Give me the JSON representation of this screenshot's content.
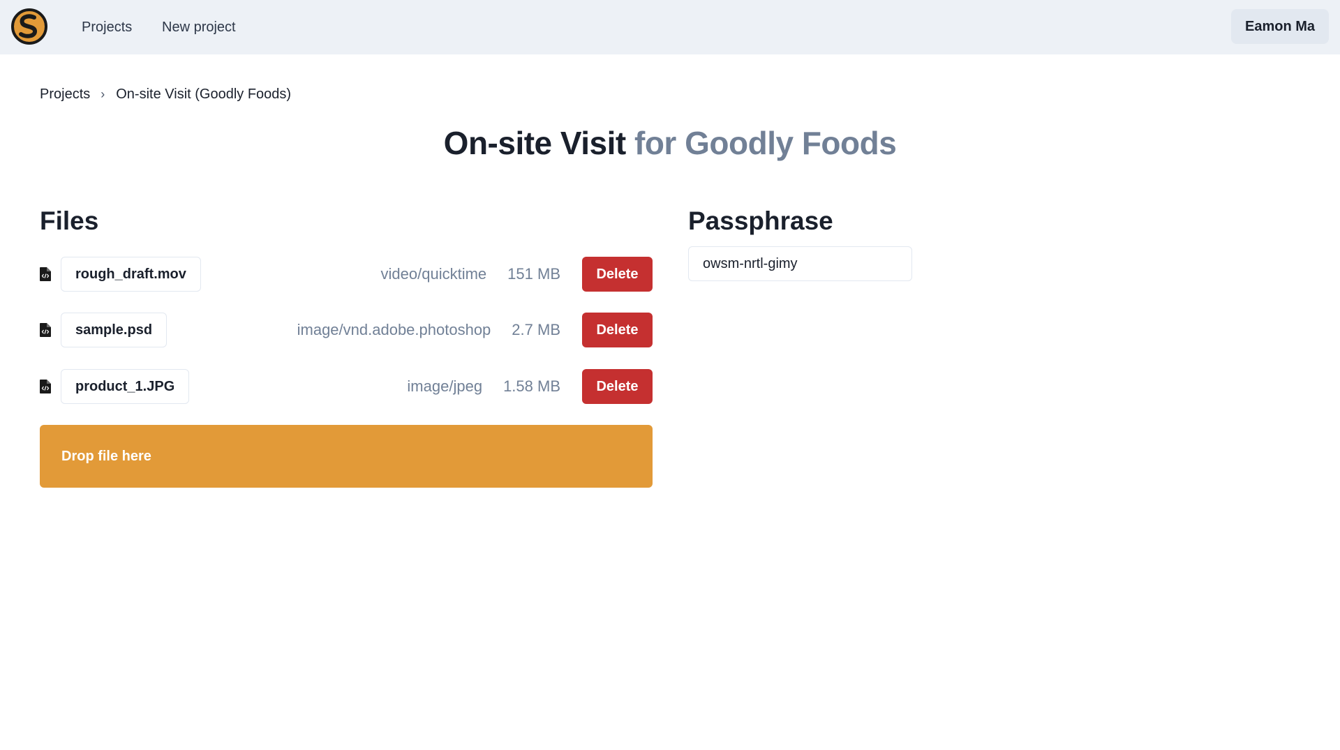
{
  "nav": {
    "logo": "app-logo",
    "links": [
      "Projects",
      "New project"
    ],
    "user": "Eamon Ma"
  },
  "breadcrumb": {
    "items": [
      "Projects",
      "On-site Visit (Goodly Foods)"
    ],
    "separator": "›"
  },
  "title": {
    "project": "On-site Visit",
    "client": "for Goodly Foods"
  },
  "files": {
    "heading": "Files",
    "rows": [
      {
        "name": "rough_draft.mov",
        "type": "video/quicktime",
        "size": "151 MB",
        "action": "Delete",
        "icon": "file-code-icon"
      },
      {
        "name": "sample.psd",
        "type": "image/vnd.adobe.photoshop",
        "size": "2.7 MB",
        "action": "Delete",
        "icon": "file-code-icon"
      },
      {
        "name": "product_1.JPG",
        "type": "image/jpeg",
        "size": "1.58 MB",
        "action": "Delete",
        "icon": "file-code-icon"
      }
    ],
    "dropzone": "Drop file here"
  },
  "passphrase": {
    "heading": "Passphrase",
    "value": "owsm-nrtl-gimy"
  },
  "colors": {
    "topbar": "#edf1f6",
    "delete": "#c53030",
    "dropzone": "#e29a38",
    "muted": "#718096"
  }
}
